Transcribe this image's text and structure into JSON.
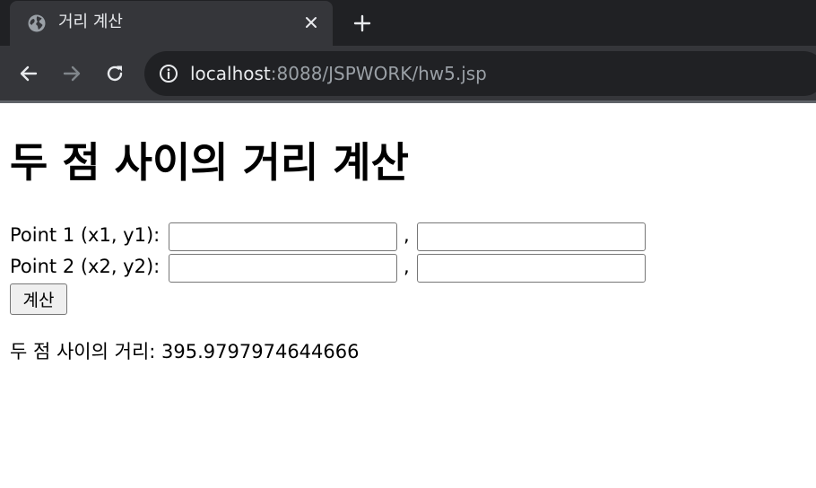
{
  "browser": {
    "tab": {
      "title": "거리 계산",
      "favicon": "globe-icon",
      "close_icon": "close-icon"
    },
    "new_tab_icon": "plus-icon",
    "nav": {
      "back_icon": "arrow-left-icon",
      "forward_icon": "arrow-right-icon",
      "reload_icon": "reload-icon"
    },
    "address_bar": {
      "info_icon": "info-icon",
      "host": "localhost",
      "rest": ":8088/JSPWORK/hw5.jsp"
    },
    "colors": {
      "tabstrip": "#202124",
      "toolbar": "#35363a",
      "text": "#e8eaed",
      "muted": "#9aa0a6"
    }
  },
  "page": {
    "title": "두 점 사이의 거리 계산",
    "point1": {
      "label": "Point 1 (x1, y1):",
      "separator": ",",
      "x_value": "",
      "y_value": ""
    },
    "point2": {
      "label": "Point 2 (x2, y2):",
      "separator": ",",
      "x_value": "",
      "y_value": ""
    },
    "submit_label": "계산",
    "result": {
      "label": "두 점 사이의 거리:",
      "value": "395.9797974644666"
    }
  }
}
